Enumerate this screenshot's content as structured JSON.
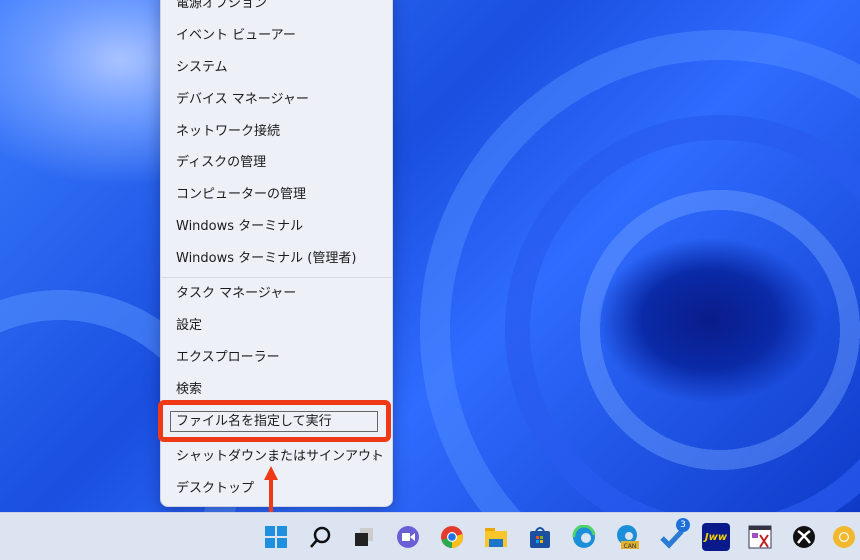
{
  "menu": {
    "items": [
      "電源オプション",
      "イベント ビューアー",
      "システム",
      "デバイス マネージャー",
      "ネットワーク接続",
      "ディスクの管理",
      "コンピューターの管理",
      "Windows ターミナル",
      "Windows ターミナル (管理者)",
      "タスク マネージャー",
      "設定",
      "エクスプローラー",
      "検索",
      "ファイル名を指定して実行",
      "シャットダウンまたはサインアウト",
      "デスクトップ"
    ],
    "highlighted": "ファイル名を指定して実行"
  },
  "taskbar": {
    "icons": [
      "start-icon",
      "search-icon",
      "task-view-icon",
      "teams-chat-icon",
      "chrome-icon",
      "file-explorer-icon",
      "store-icon",
      "edge-icon",
      "edge-canary-icon",
      "todo-icon",
      "jww-icon",
      "paint-app-icon",
      "xbox-icon",
      "chrome-canary-icon"
    ],
    "todo_badge": "3",
    "edge_canary_label": "CAN",
    "jww_label": "Jww"
  },
  "colors": {
    "highlight": "#f03a17",
    "taskbar": "#dce4f2"
  }
}
